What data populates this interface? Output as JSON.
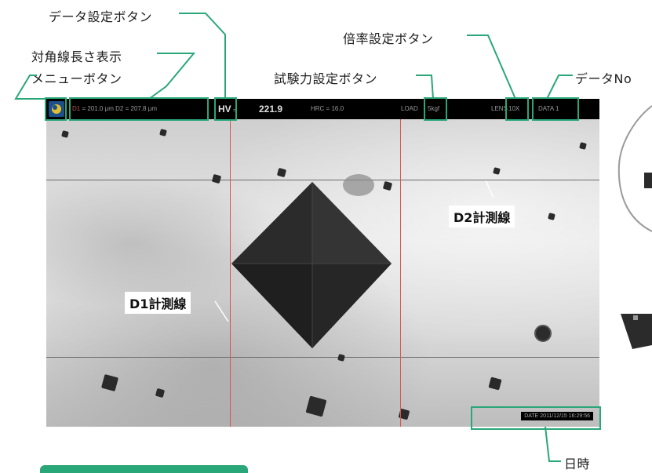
{
  "callouts": {
    "data_button": "データ設定ボタン",
    "diagonal_length": "対角線長さ表示",
    "menu_button": "メニューボタン",
    "magnification_button": "倍率設定ボタン",
    "test_force_button": "試験力設定ボタン",
    "data_no": "データNo",
    "datetime": "日時"
  },
  "toolbar": {
    "d1_label": "D1",
    "d1_value": "= 201.0 μm",
    "d2_label": "D2",
    "d2_value": "= 207.8 μm",
    "hv_label": "HV",
    "hv_eq": "=",
    "hv_value": "221.9",
    "hrc_label": "HRC =",
    "hrc_value": "16.0",
    "load_label": "LOAD",
    "load_value": "5kgf",
    "lens_label": "LENS",
    "lens_value": "10X",
    "data_label": "DATA",
    "data_value": "1"
  },
  "image_labels": {
    "d1_line": "D1計測線",
    "d2_line": "D2計測線"
  },
  "status": {
    "date": "DATE  2011/12/15 16:29:56"
  },
  "colors": {
    "highlight": "#2aa779",
    "measure_line": "#d9534f"
  }
}
